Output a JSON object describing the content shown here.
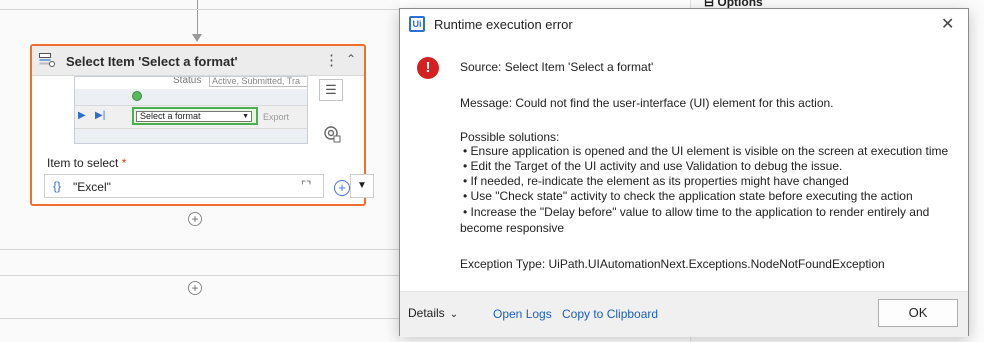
{
  "designer": {
    "activity": {
      "title": "Select Item 'Select a format'",
      "more_icon": "kebab-icon",
      "collapse_icon": "chevron-up-double-icon",
      "preview": {
        "status_label": "Status",
        "status_value": "Active, Submitted, Tra",
        "select_text": "Select a format",
        "export_text": "Export"
      },
      "field_label": "Item to select",
      "required_mark": "*",
      "field_value": "\"Excel\"",
      "expression_icon": "{}"
    },
    "add_icon": "plus-circle-icon"
  },
  "right_panel": {
    "title": "Options"
  },
  "dialog": {
    "title": "Runtime execution error",
    "logo_text": "Ui",
    "error_icon": "!",
    "source": "Source: Select Item 'Select a format'",
    "message": "Message: Could not find the user-interface (UI) element for this action.",
    "solutions_heading": "Possible solutions:",
    "solutions": [
      "•  Ensure application is opened and the UI element is visible on the screen at execution time",
      "•  Edit the Target of the UI activity and use Validation to debug the issue.",
      "•  If needed, re-indicate the element as its properties might have changed",
      "•  Use \"Check state\" activity to check the application state before executing the action",
      "•  Increase the \"Delay before\" value to allow time to the application to render entirely and",
      "become responsive"
    ],
    "exception": "Exception Type: UiPath.UIAutomationNext.Exceptions.NodeNotFoundException",
    "footer": {
      "details_label": "Details",
      "open_logs_label": "Open Logs",
      "copy_label": "Copy to Clipboard",
      "ok_label": "OK"
    }
  }
}
